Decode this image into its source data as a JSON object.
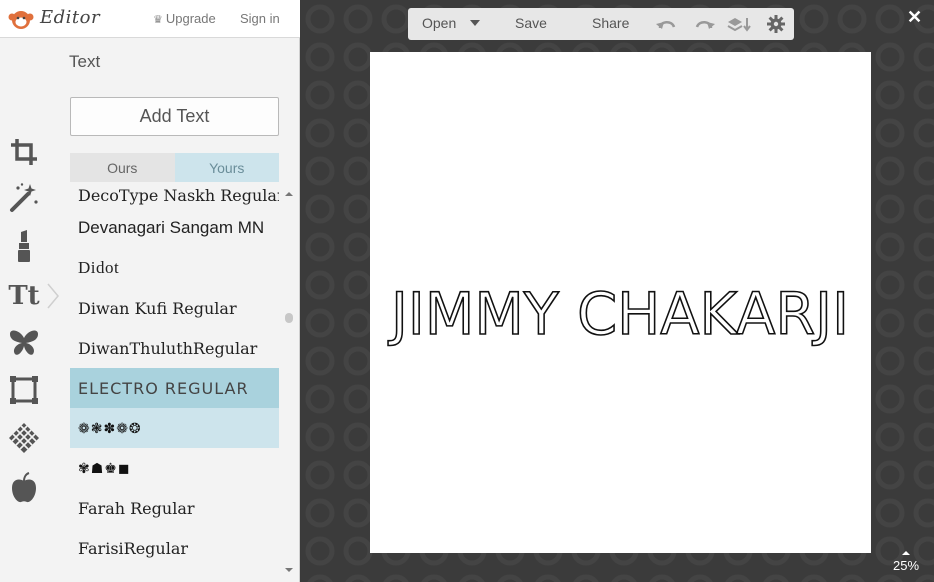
{
  "header": {
    "app_title": "Editor",
    "upgrade_label": "Upgrade",
    "signin_label": "Sign in"
  },
  "tools": [
    "crop-icon",
    "magic-wand-icon",
    "lipstick-icon",
    "text-icon",
    "butterfly-icon",
    "frame-icon",
    "texture-icon",
    "apple-icon"
  ],
  "text_tool_glyph": "Tt",
  "panel": {
    "title": "Text",
    "add_text_label": "Add Text",
    "tabs": {
      "ours": "Ours",
      "yours": "Yours",
      "active": "yours"
    },
    "fonts": [
      {
        "name": "DecoType Naskh Regular"
      },
      {
        "name": "Devanagari Sangam MN"
      },
      {
        "name": "Didot"
      },
      {
        "name": "Diwan Kufi Regular"
      },
      {
        "name": "DiwanThuluthRegular"
      },
      {
        "name": "ELECTRO REGULAR",
        "selected": true
      },
      {
        "name": "❁❃✽❁❂",
        "glyph_sample": true
      },
      {
        "name": "✾☗♚◼",
        "glyph_sample": true
      },
      {
        "name": "Farah Regular"
      },
      {
        "name": "FarisiRegular"
      }
    ]
  },
  "toolbar": {
    "open_label": "Open",
    "save_label": "Save",
    "share_label": "Share"
  },
  "canvas": {
    "text": "JIMMY CHAKARJI"
  },
  "zoom_label": "25%",
  "colors": {
    "accent_selected": "#a9d2dd",
    "accent_tab": "#cde4ec",
    "workspace_bg": "#3a3a3a",
    "logo": "#e0703c"
  }
}
